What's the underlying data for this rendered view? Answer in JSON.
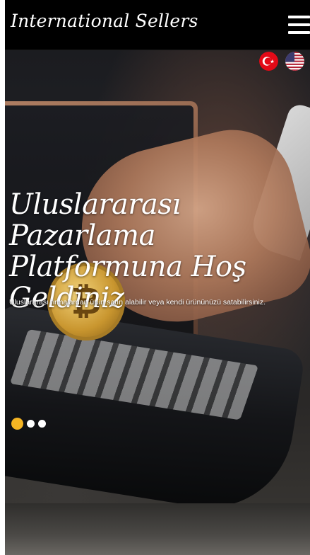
{
  "header": {
    "brand": "International Sellers",
    "menu_icon": "hamburger-menu-icon"
  },
  "languages": [
    {
      "code": "tr",
      "icon": "turkey-flag-icon",
      "color": "#e30a17"
    },
    {
      "code": "en",
      "icon": "usa-flag-icon",
      "color": "#3c3b6e"
    }
  ],
  "hero": {
    "title": "Uluslararası Pazarlama Platformuna Hoş Geldiniz",
    "subtitle": "Uluslararası firmalardan ürün satın alabilir veya kendi ürününüzü satabilirsiniz.",
    "slides_total": 3,
    "active_slide": 1
  },
  "colors": {
    "accent": "#f5b523",
    "navbar": "#000000",
    "text": "#ffffff"
  }
}
